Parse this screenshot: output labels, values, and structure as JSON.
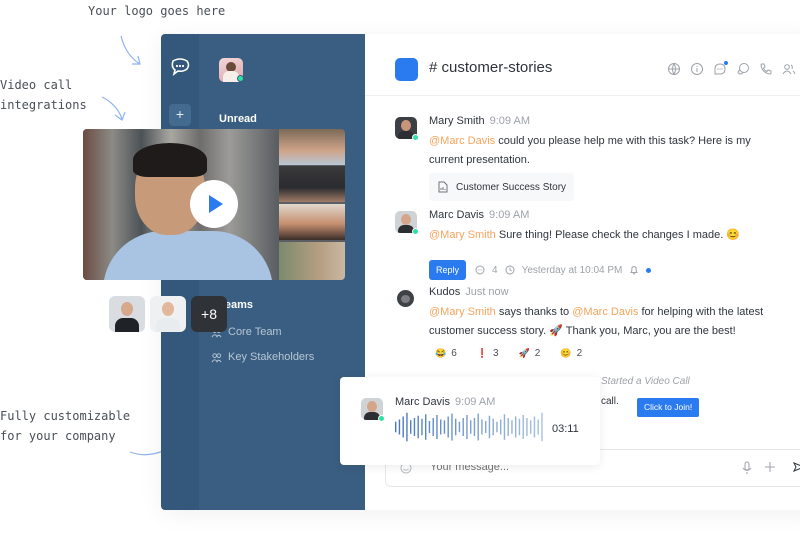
{
  "annotations": {
    "logo": "Your logo goes here",
    "video": "Video call\nintegrations",
    "custom": "Fully customizable\nfor your company"
  },
  "sidebar": {
    "section_unread": "Unread",
    "section_teams": "Teams",
    "teams": [
      {
        "label": "Core Team",
        "icon": "team-icon"
      },
      {
        "label": "Key Stakeholders",
        "icon": "team-icon"
      }
    ],
    "add_label": "+"
  },
  "header": {
    "channel_title": "# customer-stories",
    "accent": "#2b7bf0",
    "icons": [
      "globe-icon",
      "info-icon",
      "threads-icon",
      "discussion-icon",
      "call-icon",
      "members-icon"
    ]
  },
  "messages": [
    {
      "author": "Mary Smith",
      "time": "9:09 AM",
      "mention": "@Marc Davis",
      "text": " could you please help me with this task? Here is my current presentation.",
      "attachment": "Customer Success Story"
    },
    {
      "author": "Marc Davis",
      "time": "9:09 AM",
      "mention": "@Mary Smith",
      "text": " Sure thing! Please check the changes I made. 😊",
      "reply_label": "Reply",
      "reply_count": "4",
      "last_reply": "Yesterday at 10:04 PM"
    },
    {
      "author": "Kudos",
      "time": "Just now",
      "mention1": "@Mary Smith",
      "text1": " says thanks to ",
      "mention2": "@Marc Davis",
      "text2": " for helping with the latest customer success story. 🚀 Thank you, Marc, you are the best!",
      "reactions": [
        {
          "emoji": "😂",
          "count": "6"
        },
        {
          "emoji": "❗",
          "count": "3"
        },
        {
          "emoji": "🚀",
          "count": "2"
        },
        {
          "emoji": "😊",
          "count": "2"
        }
      ]
    }
  ],
  "video_call": {
    "started_label": "Started a Video Call",
    "call_word": "call.",
    "join_label": "Click to Join!",
    "extra_participants": "+8"
  },
  "audio_message": {
    "author": "Marc Davis",
    "time": "9:09 AM",
    "duration": "03:11",
    "waveform": [
      0.35,
      0.5,
      0.7,
      0.95,
      0.45,
      0.6,
      0.75,
      0.55,
      0.85,
      0.4,
      0.6,
      0.8,
      0.5,
      0.45,
      0.7,
      0.9,
      0.55,
      0.35,
      0.6,
      0.8,
      0.45,
      0.6,
      0.9,
      0.5,
      0.4,
      0.75,
      0.55,
      0.35,
      0.5,
      0.85,
      0.6,
      0.45,
      0.7,
      0.55,
      0.8,
      0.6,
      0.45,
      0.7,
      0.5,
      0.95
    ]
  },
  "composer": {
    "placeholder": "Your message..."
  }
}
